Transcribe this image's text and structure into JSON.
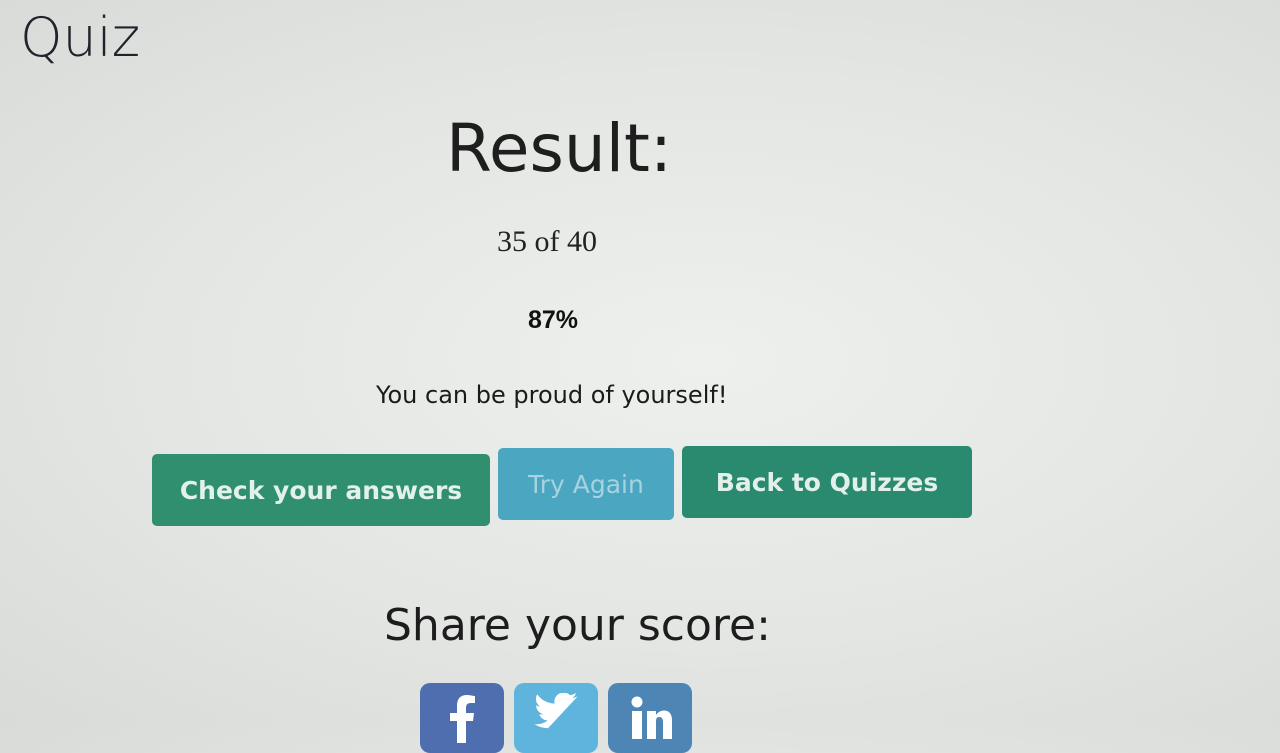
{
  "header": {
    "title": "Quiz"
  },
  "result": {
    "title": "Result:",
    "score": "35 of 40",
    "percent": "87%",
    "message": "You can be proud of yourself!"
  },
  "actions": {
    "check_label": "Check your answers",
    "try_label": "Try Again",
    "back_label": "Back to Quizzes"
  },
  "share": {
    "title": "Share your score:",
    "networks": [
      "facebook-icon",
      "twitter-icon",
      "linkedin-icon"
    ]
  },
  "colors": {
    "primary_green": "#2f8f6e",
    "try_blue": "#4aa6c1",
    "facebook": "#4f6eb0",
    "twitter": "#5fb4de",
    "linkedin": "#4d86b5"
  }
}
